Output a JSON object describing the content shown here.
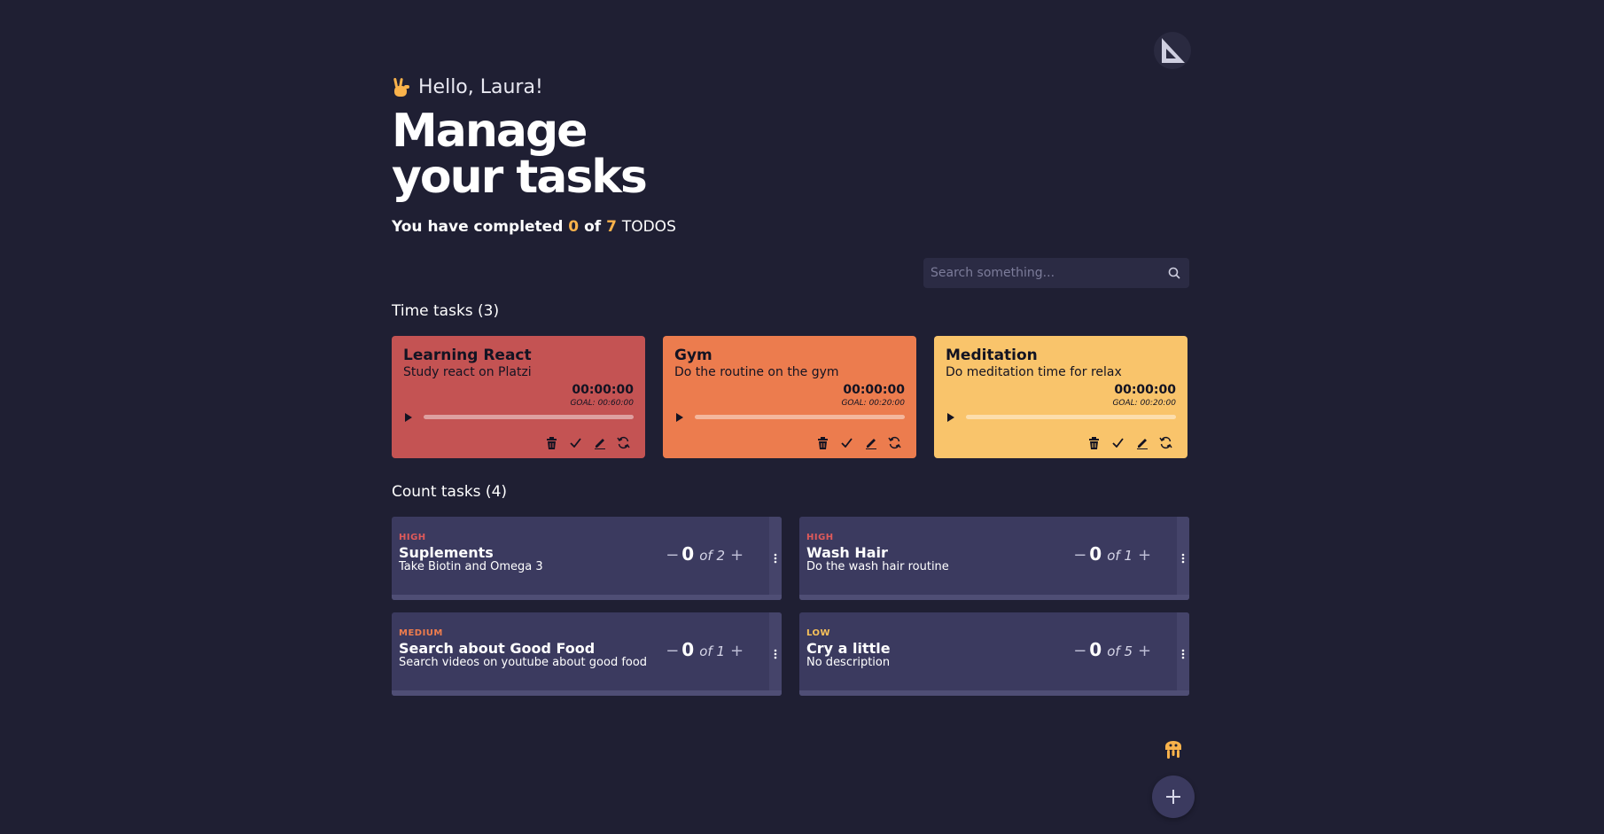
{
  "header": {
    "greeting": "Hello, Laura!",
    "title_line1": "Manage",
    "title_line2": "your tasks",
    "summary_prefix": "You have completed",
    "completed": "0",
    "summary_of": "of",
    "total": "7",
    "summary_unit": "TODOS"
  },
  "search": {
    "placeholder": "Search something..."
  },
  "time_tasks": {
    "title": "Time tasks (3)",
    "items": [
      {
        "name": "Learning React",
        "description": "Study react on Platzi",
        "timer": "00:00:00",
        "goal": "GOAL: 00:60:00",
        "color": "#c45353",
        "progress": 0
      },
      {
        "name": "Gym",
        "description": "Do the routine on the gym",
        "timer": "00:00:00",
        "goal": "GOAL: 00:20:00",
        "color": "#ec7c4e",
        "progress": 0
      },
      {
        "name": "Meditation",
        "description": "Do meditation time for relax",
        "timer": "00:00:00",
        "goal": "GOAL: 00:20:00",
        "color": "#f9c46b",
        "progress": 0
      }
    ]
  },
  "count_tasks": {
    "title": "Count tasks (4)",
    "items": [
      {
        "priority": "HIGH",
        "priority_color": "#e05a5a",
        "name": "Suplements",
        "description": "Take Biotin and Omega 3",
        "current": "0",
        "of_label": "of 2"
      },
      {
        "priority": "HIGH",
        "priority_color": "#e05a5a",
        "name": "Wash Hair",
        "description": "Do the wash hair routine",
        "current": "0",
        "of_label": "of 1"
      },
      {
        "priority": "MEDIUM",
        "priority_color": "#ef7d4d",
        "name": "Search about Good Food",
        "description": "Search videos on youtube about good food",
        "current": "0",
        "of_label": "of 1"
      },
      {
        "priority": "LOW",
        "priority_color": "#f7c15a",
        "name": "Cry a little",
        "description": "No description",
        "current": "0",
        "of_label": "of 5"
      }
    ]
  },
  "colors": {
    "background": "#1f1f33",
    "accent": "#f9b24b",
    "card": "#3b3a5f"
  }
}
